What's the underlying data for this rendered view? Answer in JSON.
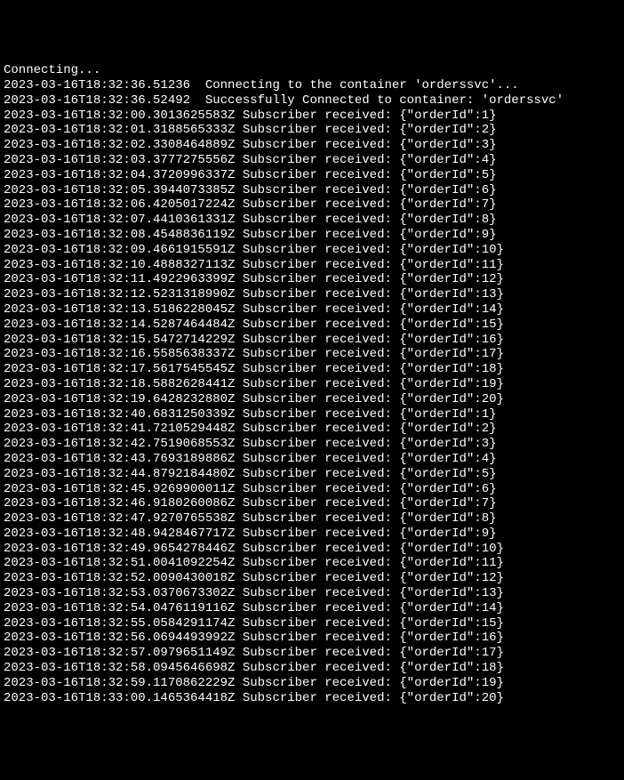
{
  "terminal": {
    "connecting": "Connecting...",
    "connect_msg": "2023-03-16T18:32:36.51236  Connecting to the container 'orderssvc'...",
    "connected_msg": "2023-03-16T18:32:36.52492  Successfully Connected to container: 'orderssvc'",
    "logs": [
      {
        "ts": "2023-03-16T18:32:00.3013625583Z",
        "msg": "Subscriber received: {\"orderId\":1}"
      },
      {
        "ts": "2023-03-16T18:32:01.3188565333Z",
        "msg": "Subscriber received: {\"orderId\":2}"
      },
      {
        "ts": "2023-03-16T18:32:02.3308464889Z",
        "msg": "Subscriber received: {\"orderId\":3}"
      },
      {
        "ts": "2023-03-16T18:32:03.3777275556Z",
        "msg": "Subscriber received: {\"orderId\":4}"
      },
      {
        "ts": "2023-03-16T18:32:04.3720996337Z",
        "msg": "Subscriber received: {\"orderId\":5}"
      },
      {
        "ts": "2023-03-16T18:32:05.3944073385Z",
        "msg": "Subscriber received: {\"orderId\":6}"
      },
      {
        "ts": "2023-03-16T18:32:06.4205017224Z",
        "msg": "Subscriber received: {\"orderId\":7}"
      },
      {
        "ts": "2023-03-16T18:32:07.4410361331Z",
        "msg": "Subscriber received: {\"orderId\":8}"
      },
      {
        "ts": "2023-03-16T18:32:08.4548836119Z",
        "msg": "Subscriber received: {\"orderId\":9}"
      },
      {
        "ts": "2023-03-16T18:32:09.4661915591Z",
        "msg": "Subscriber received: {\"orderId\":10}"
      },
      {
        "ts": "2023-03-16T18:32:10.4888327113Z",
        "msg": "Subscriber received: {\"orderId\":11}"
      },
      {
        "ts": "2023-03-16T18:32:11.4922963399Z",
        "msg": "Subscriber received: {\"orderId\":12}"
      },
      {
        "ts": "2023-03-16T18:32:12.5231318990Z",
        "msg": "Subscriber received: {\"orderId\":13}"
      },
      {
        "ts": "2023-03-16T18:32:13.5186228045Z",
        "msg": "Subscriber received: {\"orderId\":14}"
      },
      {
        "ts": "2023-03-16T18:32:14.5287464484Z",
        "msg": "Subscriber received: {\"orderId\":15}"
      },
      {
        "ts": "2023-03-16T18:32:15.5472714229Z",
        "msg": "Subscriber received: {\"orderId\":16}"
      },
      {
        "ts": "2023-03-16T18:32:16.5585638337Z",
        "msg": "Subscriber received: {\"orderId\":17}"
      },
      {
        "ts": "2023-03-16T18:32:17.5617545545Z",
        "msg": "Subscriber received: {\"orderId\":18}"
      },
      {
        "ts": "2023-03-16T18:32:18.5882628441Z",
        "msg": "Subscriber received: {\"orderId\":19}"
      },
      {
        "ts": "2023-03-16T18:32:19.6428232880Z",
        "msg": "Subscriber received: {\"orderId\":20}"
      },
      {
        "ts": "2023-03-16T18:32:40.6831250339Z",
        "msg": "Subscriber received: {\"orderId\":1}"
      },
      {
        "ts": "2023-03-16T18:32:41.7210529448Z",
        "msg": "Subscriber received: {\"orderId\":2}"
      },
      {
        "ts": "2023-03-16T18:32:42.7519068553Z",
        "msg": "Subscriber received: {\"orderId\":3}"
      },
      {
        "ts": "2023-03-16T18:32:43.7693189886Z",
        "msg": "Subscriber received: {\"orderId\":4}"
      },
      {
        "ts": "2023-03-16T18:32:44.8792184480Z",
        "msg": "Subscriber received: {\"orderId\":5}"
      },
      {
        "ts": "2023-03-16T18:32:45.9269900011Z",
        "msg": "Subscriber received: {\"orderId\":6}"
      },
      {
        "ts": "2023-03-16T18:32:46.9180260086Z",
        "msg": "Subscriber received: {\"orderId\":7}"
      },
      {
        "ts": "2023-03-16T18:32:47.9270765538Z",
        "msg": "Subscriber received: {\"orderId\":8}"
      },
      {
        "ts": "2023-03-16T18:32:48.9428467717Z",
        "msg": "Subscriber received: {\"orderId\":9}"
      },
      {
        "ts": "2023-03-16T18:32:49.9654278446Z",
        "msg": "Subscriber received: {\"orderId\":10}"
      },
      {
        "ts": "2023-03-16T18:32:51.0041092254Z",
        "msg": "Subscriber received: {\"orderId\":11}"
      },
      {
        "ts": "2023-03-16T18:32:52.0090430018Z",
        "msg": "Subscriber received: {\"orderId\":12}"
      },
      {
        "ts": "2023-03-16T18:32:53.0370673302Z",
        "msg": "Subscriber received: {\"orderId\":13}"
      },
      {
        "ts": "2023-03-16T18:32:54.0476119116Z",
        "msg": "Subscriber received: {\"orderId\":14}"
      },
      {
        "ts": "2023-03-16T18:32:55.0584291174Z",
        "msg": "Subscriber received: {\"orderId\":15}"
      },
      {
        "ts": "2023-03-16T18:32:56.0694493992Z",
        "msg": "Subscriber received: {\"orderId\":16}"
      },
      {
        "ts": "2023-03-16T18:32:57.0979651149Z",
        "msg": "Subscriber received: {\"orderId\":17}"
      },
      {
        "ts": "2023-03-16T18:32:58.0945646698Z",
        "msg": "Subscriber received: {\"orderId\":18}"
      },
      {
        "ts": "2023-03-16T18:32:59.1170862229Z",
        "msg": "Subscriber received: {\"orderId\":19}"
      },
      {
        "ts": "2023-03-16T18:33:00.1465364418Z",
        "msg": "Subscriber received: {\"orderId\":20}"
      }
    ]
  }
}
